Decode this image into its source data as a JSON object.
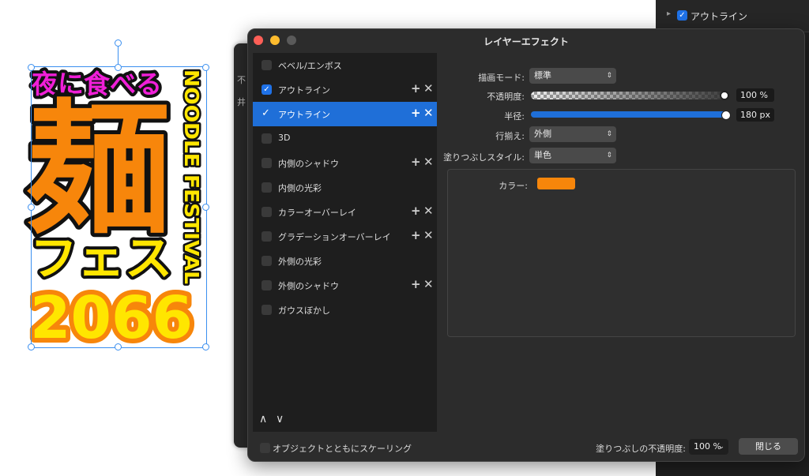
{
  "artwork": {
    "line1": "夜に食べる",
    "big_char": "麺",
    "line3": "フェス",
    "year": "2066",
    "vertical_text": "NOODLE FESTIVAL",
    "colors": {
      "pink": "#f01fd8",
      "orange": "#f7860b",
      "yellow": "#ffe600",
      "black": "#111111"
    }
  },
  "right_panel": {
    "row_label": "アウトライン",
    "row_checked": true
  },
  "background_window": {
    "items": [
      "不",
      "井"
    ]
  },
  "dialog": {
    "title": "レイヤーエフェクト",
    "effects": [
      {
        "label": "ベベル/エンボス",
        "checked": false,
        "has_actions": false
      },
      {
        "label": "アウトライン",
        "checked": true,
        "has_actions": true
      },
      {
        "label": "アウトライン",
        "checked": true,
        "has_actions": true,
        "selected": true
      },
      {
        "label": "3D",
        "checked": false,
        "has_actions": false
      },
      {
        "label": "内側のシャドウ",
        "checked": false,
        "has_actions": true
      },
      {
        "label": "内側の光彩",
        "checked": false,
        "has_actions": false
      },
      {
        "label": "カラーオーバーレイ",
        "checked": false,
        "has_actions": true
      },
      {
        "label": "グラデーションオーバーレイ",
        "checked": false,
        "has_actions": true
      },
      {
        "label": "外側の光彩",
        "checked": false,
        "has_actions": false
      },
      {
        "label": "外側のシャドウ",
        "checked": false,
        "has_actions": true
      },
      {
        "label": "ガウスぼかし",
        "checked": false,
        "has_actions": false
      }
    ],
    "add_glyph": "+",
    "delete_glyph": "✕",
    "move_up_glyph": "∧",
    "move_down_glyph": "∨",
    "settings": {
      "blend_mode_label": "描画モード:",
      "blend_mode_value": "標準",
      "opacity_label": "不透明度:",
      "opacity_value": "100 %",
      "opacity_fraction": 1.0,
      "radius_label": "半径:",
      "radius_value": "180 px",
      "radius_fraction": 1.0,
      "align_label": "行揃え:",
      "align_value": "外側",
      "fill_style_label": "塗りつぶしスタイル:",
      "fill_style_value": "単色",
      "color_label": "カラー:",
      "color_value": "#f7860b"
    },
    "footer": {
      "scale_label": "オブジェクトとともにスケーリング",
      "scale_checked": false,
      "fill_opacity_label": "塗りつぶしの不透明度:",
      "fill_opacity_value": "100 %",
      "close_label": "閉じる"
    },
    "traffic_colors": {
      "close": "#fe5f57",
      "minimize": "#febc2e",
      "zoom": "#5a5a5a"
    }
  }
}
